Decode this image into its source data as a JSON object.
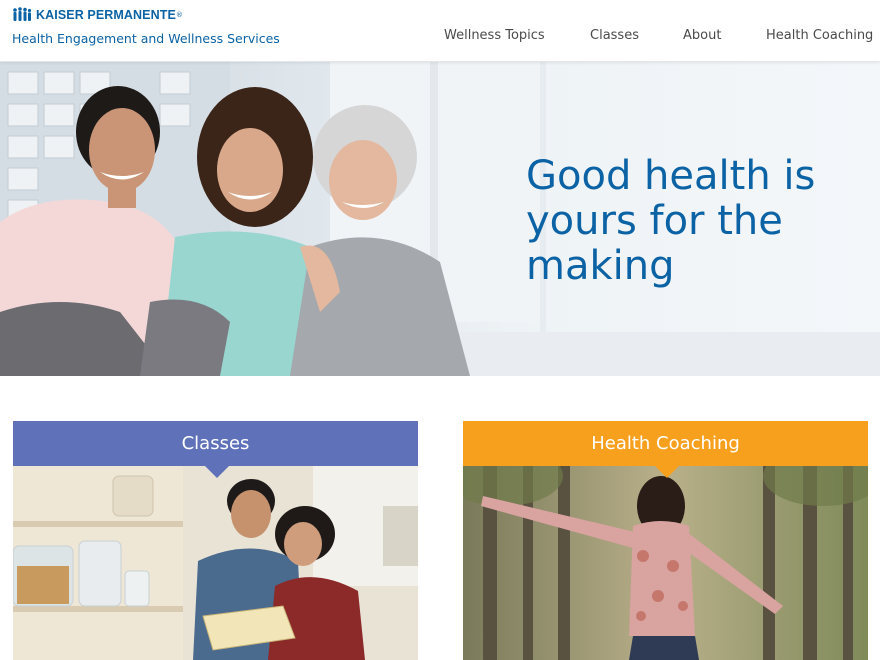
{
  "header": {
    "brand": "KAISER PERMANENTE",
    "brand_mark": "®",
    "subtitle": "Health Engagement and Wellness Services",
    "nav": [
      {
        "label": "Wellness Topics"
      },
      {
        "label": "Classes"
      },
      {
        "label": "About"
      },
      {
        "label": "Health Coaching"
      }
    ]
  },
  "hero": {
    "headline": "Good health is yours for the making",
    "image": "three-smiling-women-photo"
  },
  "cards": [
    {
      "title": "Classes",
      "image": "couple-reading-in-kitchen-photo",
      "color": "#5f71b8"
    },
    {
      "title": "Health Coaching",
      "image": "woman-arms-outstretched-forest-photo",
      "color": "#f7a01e"
    }
  ],
  "colors": {
    "brand_blue": "#0b62a4",
    "nav_text": "#4a4a4a"
  }
}
